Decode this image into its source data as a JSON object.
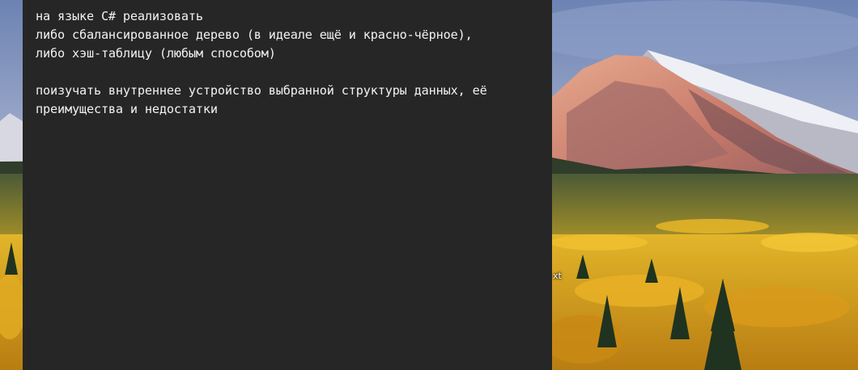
{
  "editor": {
    "lines": [
      "на языке C# реализовать",
      "либо сбалансированное дерево (в идеале ещё и красно-чёрное),",
      "либо хэш-таблицу (любым способом)",
      "",
      "поизучать внутреннее устройство выбранной структуры данных, её",
      "преимущества и недостатки"
    ]
  },
  "desktop": {
    "file_label": "xt"
  },
  "colors": {
    "editor_bg": "#262626",
    "editor_text": "#f2f2f2",
    "sky": "#6f88b6",
    "foliage": "#d9a21c"
  }
}
